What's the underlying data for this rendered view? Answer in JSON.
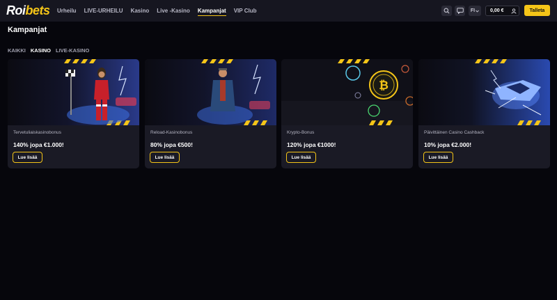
{
  "header": {
    "logo_part1": "Roi",
    "logo_part2": "bets",
    "nav": [
      "Urheilu",
      "LIVE-URHEILU",
      "Kasino",
      "Live -Kasino",
      "Kampanjat",
      "VIP Club"
    ],
    "active_nav": "Kampanjat",
    "language": "FI",
    "balance": "0,00 €",
    "deposit_label": "Talleta"
  },
  "page": {
    "title": "Kampanjat",
    "filters": [
      "KAIKKI",
      "KASINO",
      "LIVE-KASINO"
    ],
    "active_filter": "KASINO"
  },
  "cards": [
    {
      "subtitle": "Tervetuliaiskasinobonus",
      "title": "140% jopa €1.000!",
      "button": "Lue lisää"
    },
    {
      "subtitle": "Reload-Kasinobonus",
      "title": "80% jopa €500!",
      "button": "Lue lisää"
    },
    {
      "subtitle": "Krypto-Bonus",
      "title": "120% jopa €1000!",
      "button": "Lue lisää"
    },
    {
      "subtitle": "Päivittäinen Casino Cashback",
      "title": "10% jopa €2.000!",
      "button": "Lue lisää"
    }
  ],
  "colors": {
    "accent": "#f5c518",
    "background": "#06060c",
    "header": "#161620",
    "card": "#1a1a25"
  },
  "icons": [
    "search-icon",
    "chat-icon",
    "chevron-down-icon",
    "user-icon"
  ]
}
